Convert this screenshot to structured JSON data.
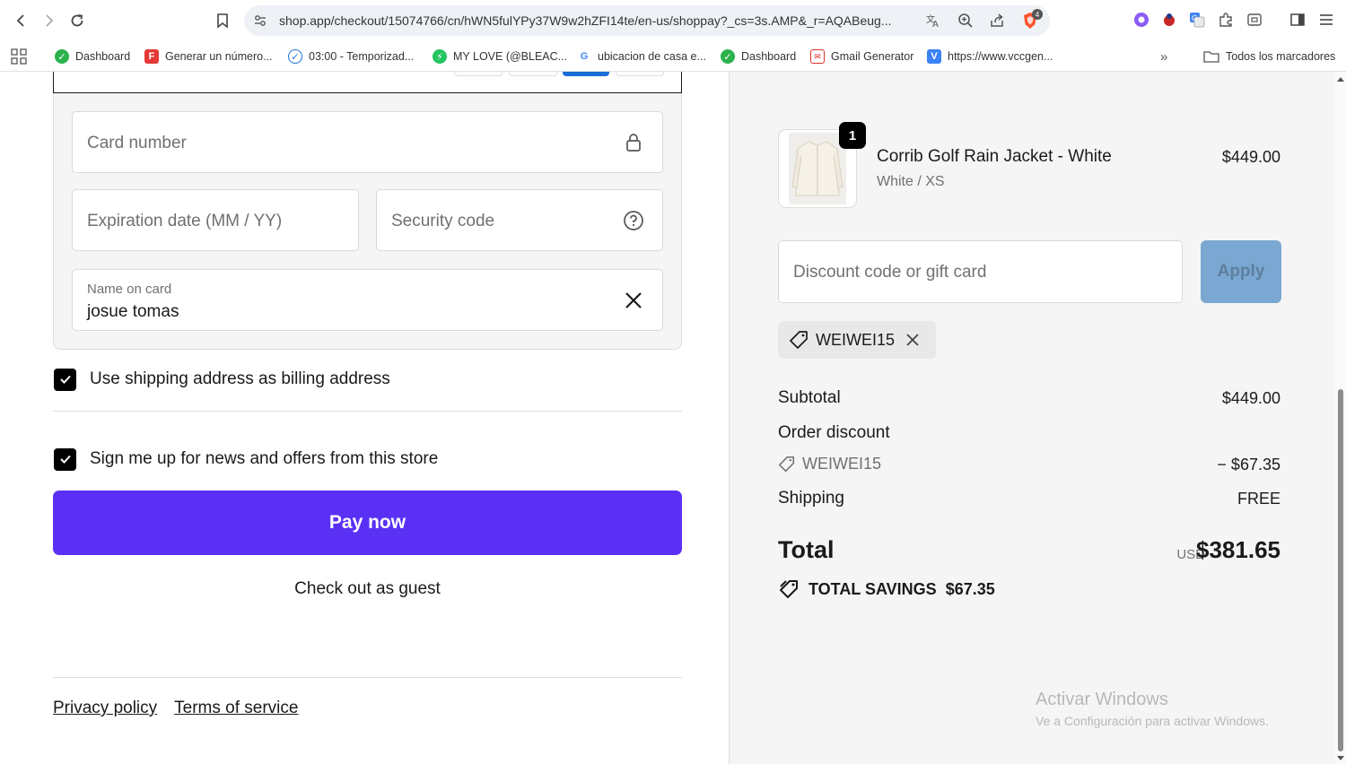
{
  "browser": {
    "url": "shop.app/checkout/15074766/cn/hWN5fulYPy37W9w2hZFI14te/en-us/shoppay?_cs=3s.AMP&_r=AQABeug...",
    "brave_badge": "4",
    "bookmarks": [
      {
        "label": "Dashboard",
        "icon": "green-check-icon",
        "color": "#2bb24c"
      },
      {
        "label": "Generar un número...",
        "icon": "f-logo-icon",
        "color": "#e53935"
      },
      {
        "label": "03:00 - Temporizad...",
        "icon": "timer-check-icon",
        "color": "#1e6fd9"
      },
      {
        "label": "MY LOVE (@BLEAC...",
        "icon": "bolt-icon",
        "color": "#22c55e"
      },
      {
        "label": "ubicacion de casa e...",
        "icon": "google-g-icon",
        "color": "#4285f4"
      },
      {
        "label": "Dashboard",
        "icon": "green-check-icon",
        "color": "#2bb24c"
      },
      {
        "label": "Gmail Generator",
        "icon": "gmail-gen-icon",
        "color": "#d93025"
      },
      {
        "label": "https://www.vccgen...",
        "icon": "v-logo-icon",
        "color": "#3b82f6"
      }
    ],
    "all_bookmarks": "Todos los marcadores"
  },
  "payment": {
    "card_number_placeholder": "Card number",
    "expiration_placeholder": "Expiration date (MM / YY)",
    "security_code_placeholder": "Security code",
    "name_label": "Name on card",
    "name_value": "josue tomas"
  },
  "checkboxes": {
    "billing_same": "Use shipping address as billing address",
    "newsletter": "Sign me up for news and offers from this store"
  },
  "actions": {
    "pay_now": "Pay now",
    "guest": "Check out as guest"
  },
  "footer": {
    "privacy": "Privacy policy",
    "terms": "Terms of service"
  },
  "summary": {
    "product": {
      "quantity": "1",
      "name": "Corrib Golf Rain Jacket - White",
      "variant": "White / XS",
      "price": "$449.00"
    },
    "discount_placeholder": "Discount code or gift card",
    "apply_label": "Apply",
    "applied_code": "WEIWEI15",
    "subtotal_label": "Subtotal",
    "subtotal_value": "$449.00",
    "order_discount_label": "Order discount",
    "discount_code": "WEIWEI15",
    "discount_value": "− $67.35",
    "shipping_label": "Shipping",
    "shipping_value": "FREE",
    "total_label": "Total",
    "currency": "USD",
    "total_value": "$381.65",
    "savings_label": "TOTAL SAVINGS",
    "savings_value": "$67.35"
  },
  "watermark": {
    "title": "Activar Windows",
    "subtitle": "Ve a Configuración para activar Windows."
  },
  "colors": {
    "pay_button": "#5a31f4",
    "apply_button": "#7aa8d2",
    "summary_bg": "#f5f5f5"
  }
}
